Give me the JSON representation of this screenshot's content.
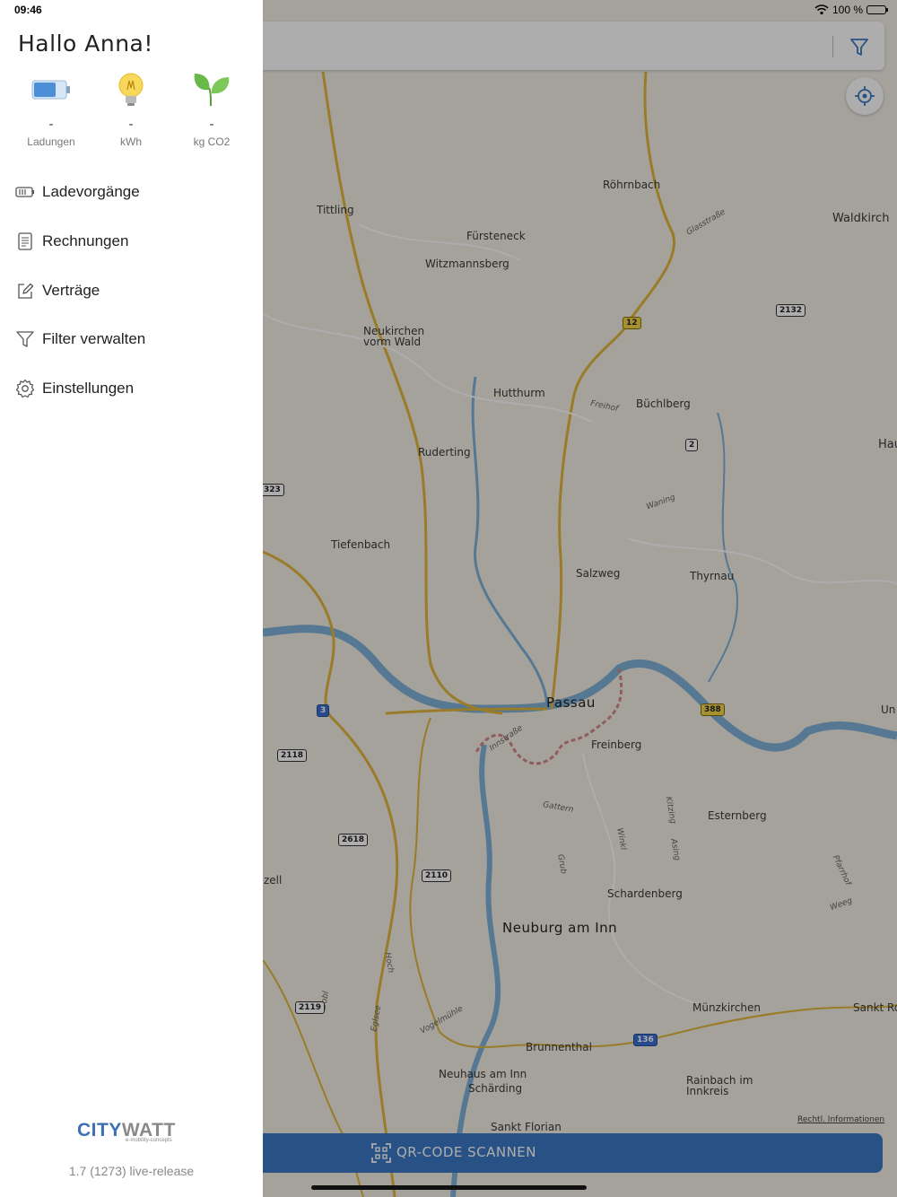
{
  "status_bar": {
    "time": "09:46",
    "battery": "100 %"
  },
  "drawer": {
    "greeting": "Hallo Anna!",
    "stats": [
      {
        "icon": "battery-icon",
        "value": "-",
        "label": "Ladungen"
      },
      {
        "icon": "lightbulb-icon",
        "value": "-",
        "label": "kWh"
      },
      {
        "icon": "leaf-icon",
        "value": "-",
        "label": "kg CO2"
      }
    ],
    "menu": [
      {
        "icon": "battery-outline-icon",
        "label": "Ladevorgänge"
      },
      {
        "icon": "document-icon",
        "label": "Rechnungen"
      },
      {
        "icon": "edit-icon",
        "label": "Verträge"
      },
      {
        "icon": "filter-icon",
        "label": "Filter verwalten"
      },
      {
        "icon": "gear-icon",
        "label": "Einstellungen"
      }
    ],
    "logo": {
      "city": "CITY",
      "watt": "WATT",
      "tagline": "e-mobility-concepts"
    },
    "version": "1.7 (1273) live-release"
  },
  "map": {
    "labels": {
      "passau": "Passau",
      "neuburg": "Neuburg am Inn",
      "roehrnbach": "Röhrnbach",
      "waldkirchen": "Waldkirch",
      "tittling": "Tittling",
      "fuersteneck": "Fürsteneck",
      "witzmannsberg": "Witzmannsberg",
      "neukirchen": "Neukirchen\nvorm Wald",
      "hutthurm": "Hutthurm",
      "buechlberg": "Büchlberg",
      "ruderting": "Ruderting",
      "tiefenbach": "Tiefenbach",
      "salzweg": "Salzweg",
      "thyrnau": "Thyrnau",
      "freinberg": "Freinberg",
      "esternberg": "Esternberg",
      "schardenberg": "Schardenberg",
      "muenzkirchen": "Münzkirchen",
      "sankt_ro": "Sankt Ro",
      "brunnenthal": "Brunnenthal",
      "neuhaus": "Neuhaus am Inn",
      "schaerding": "Schärding",
      "rainbach": "Rainbach im\nInnkreis",
      "sankt_florian": "Sankt Florian",
      "zell": "zell",
      "hau": "Hau",
      "un": "Un",
      "freihof": "Freihof",
      "waning": "Waning",
      "glasstrasse": "Glasstraße",
      "innstrasse": "Innstraße",
      "gattern": "Gattern",
      "grub": "Grub",
      "winkl": "Winkl",
      "kitzing": "Kitzing",
      "asing": "Asing",
      "pfarrhof": "Pfarrhof",
      "weeg": "Weeg",
      "hoch": "Hoch",
      "dobl": "Dobl",
      "eglsee": "Eglsee",
      "vogelmuehle": "Vogelmühle"
    },
    "road_numbers": {
      "r12": "12",
      "r2": "2",
      "r2132": "2132",
      "r388": "388",
      "r3": "3",
      "r2118": "2118",
      "r2618": "2618",
      "r2110": "2110",
      "r2119": "2119",
      "r136": "136",
      "r323": "323"
    },
    "legal_link": "Rechtl. Informationen",
    "qr_button": "QR-CODE SCANNEN"
  },
  "colors": {
    "accent": "#3c79c4",
    "logo_blue": "#3d6fb3",
    "river": "#7fb2d9",
    "road_yellow": "#e2b63b"
  }
}
